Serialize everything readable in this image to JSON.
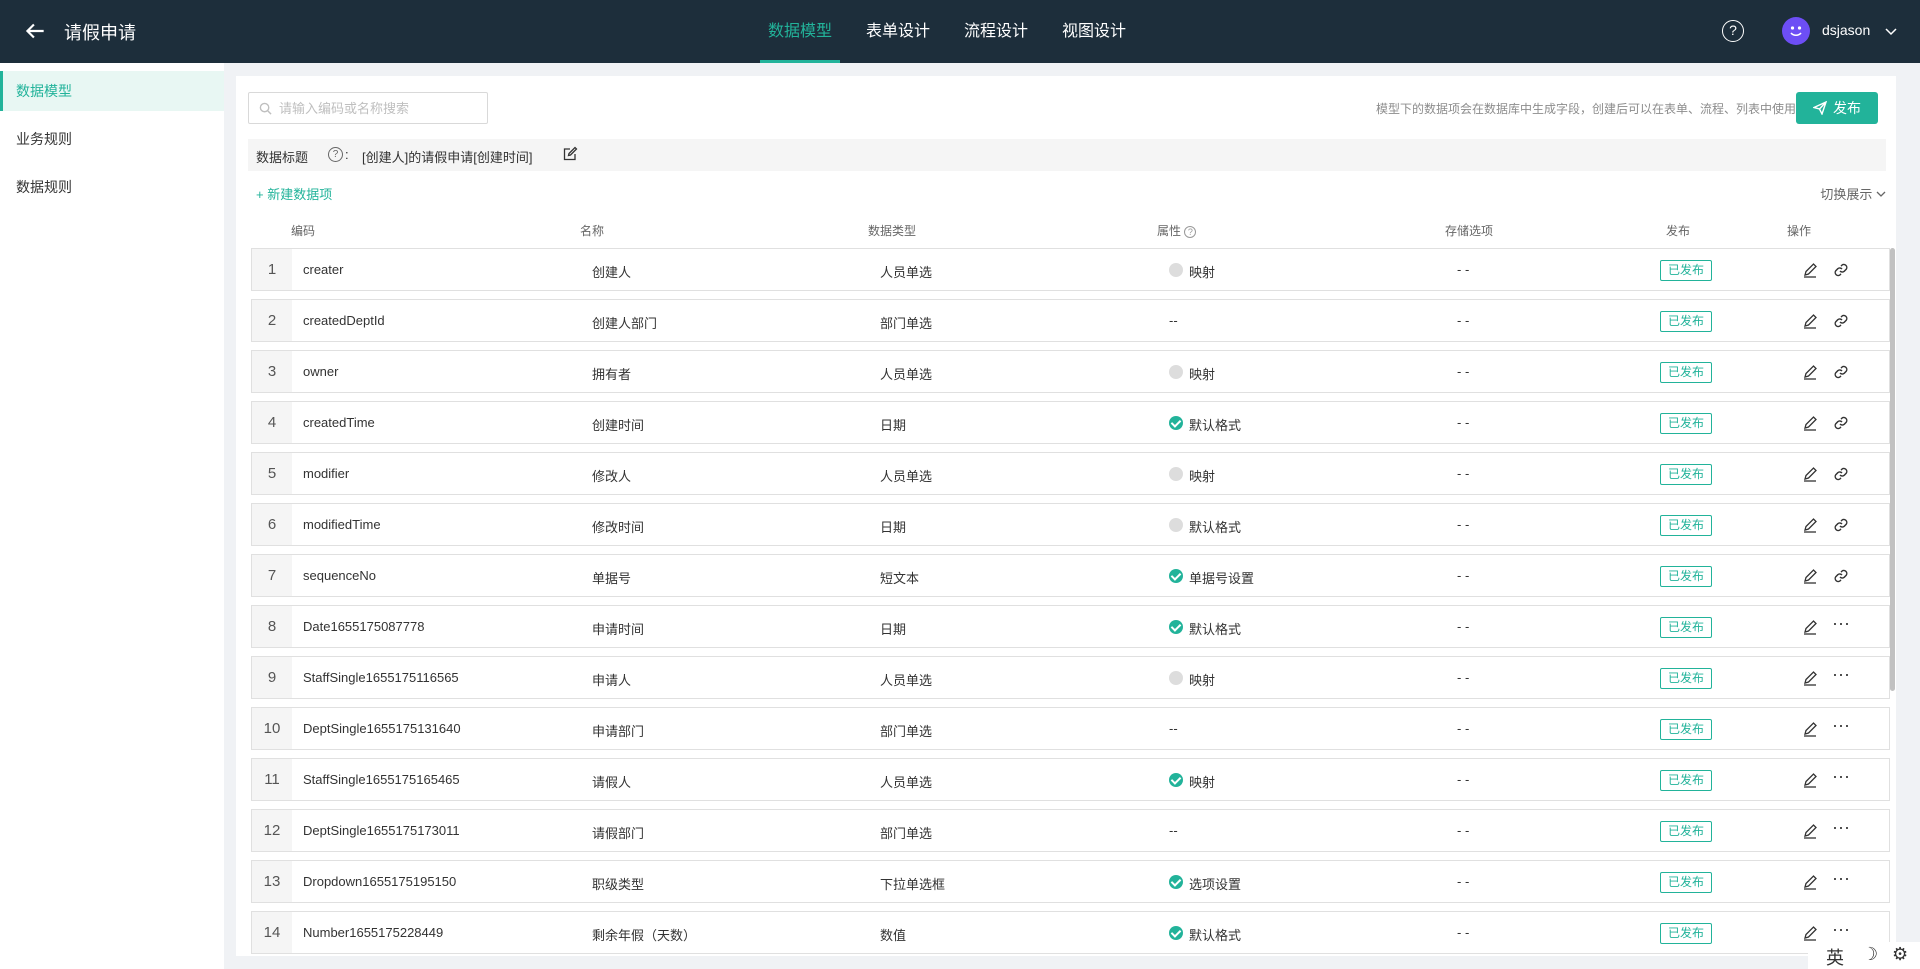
{
  "header": {
    "app_title": "请假申请",
    "tabs": [
      {
        "label": "数据模型",
        "active": true
      },
      {
        "label": "表单设计",
        "active": false
      },
      {
        "label": "流程设计",
        "active": false
      },
      {
        "label": "视图设计",
        "active": false
      }
    ],
    "help_label": "?",
    "user_name": "dsjason",
    "accent_color": "#22b39a",
    "bar_color": "#1d2e3b"
  },
  "sidebar": {
    "items": [
      {
        "label": "数据模型",
        "active": true
      },
      {
        "label": "业务规则",
        "active": false
      },
      {
        "label": "数据规则",
        "active": false
      }
    ]
  },
  "toolbar": {
    "search_placeholder": "请输入编码或名称搜索",
    "hint": "模型下的数据项会在数据库中生成字段，创建后可以在表单、流程、列表中使用。",
    "publish_label": "发布"
  },
  "title_bar": {
    "label": "数据标题",
    "help": "?",
    "colon": ":",
    "value": "[创建人]的请假申请[创建时间]"
  },
  "actions": {
    "new_item": "+ 新建数据项",
    "switch_view": "切换展示"
  },
  "table": {
    "headers": {
      "code": "编码",
      "name": "名称",
      "type": "数据类型",
      "attr": "属性",
      "storage": "存储选项",
      "publish": "发布",
      "ops": "操作"
    },
    "rows": [
      {
        "no": "1",
        "code": "creater",
        "name": "创建人",
        "type": "人员单选",
        "attr": "映射",
        "attr_on": false,
        "storage": "- -",
        "status": "已发布",
        "op": "link"
      },
      {
        "no": "2",
        "code": "createdDeptId",
        "name": "创建人部门",
        "type": "部门单选",
        "attr": "--",
        "attr_on": null,
        "storage": "- -",
        "status": "已发布",
        "op": "link"
      },
      {
        "no": "3",
        "code": "owner",
        "name": "拥有者",
        "type": "人员单选",
        "attr": "映射",
        "attr_on": false,
        "storage": "- -",
        "status": "已发布",
        "op": "link"
      },
      {
        "no": "4",
        "code": "createdTime",
        "name": "创建时间",
        "type": "日期",
        "attr": "默认格式",
        "attr_on": true,
        "storage": "- -",
        "status": "已发布",
        "op": "link"
      },
      {
        "no": "5",
        "code": "modifier",
        "name": "修改人",
        "type": "人员单选",
        "attr": "映射",
        "attr_on": false,
        "storage": "- -",
        "status": "已发布",
        "op": "link"
      },
      {
        "no": "6",
        "code": "modifiedTime",
        "name": "修改时间",
        "type": "日期",
        "attr": "默认格式",
        "attr_on": false,
        "storage": "- -",
        "status": "已发布",
        "op": "link"
      },
      {
        "no": "7",
        "code": "sequenceNo",
        "name": "单据号",
        "type": "短文本",
        "attr": "单据号设置",
        "attr_on": true,
        "storage": "- -",
        "status": "已发布",
        "op": "link"
      },
      {
        "no": "8",
        "code": "Date1655175087778",
        "name": "申请时间",
        "type": "日期",
        "attr": "默认格式",
        "attr_on": true,
        "storage": "- -",
        "status": "已发布",
        "op": "more"
      },
      {
        "no": "9",
        "code": "StaffSingle1655175116565",
        "name": "申请人",
        "type": "人员单选",
        "attr": "映射",
        "attr_on": false,
        "storage": "- -",
        "status": "已发布",
        "op": "more"
      },
      {
        "no": "10",
        "code": "DeptSingle1655175131640",
        "name": "申请部门",
        "type": "部门单选",
        "attr": "--",
        "attr_on": null,
        "storage": "- -",
        "status": "已发布",
        "op": "more"
      },
      {
        "no": "11",
        "code": "StaffSingle1655175165465",
        "name": "请假人",
        "type": "人员单选",
        "attr": "映射",
        "attr_on": true,
        "storage": "- -",
        "status": "已发布",
        "op": "more"
      },
      {
        "no": "12",
        "code": "DeptSingle1655175173011",
        "name": "请假部门",
        "type": "部门单选",
        "attr": "--",
        "attr_on": null,
        "storage": "- -",
        "status": "已发布",
        "op": "more"
      },
      {
        "no": "13",
        "code": "Dropdown1655175195150",
        "name": "职级类型",
        "type": "下拉单选框",
        "attr": "选项设置",
        "attr_on": true,
        "storage": "- -",
        "status": "已发布",
        "op": "more"
      },
      {
        "no": "14",
        "code": "Number1655175228449",
        "name": "剩余年假（天数）",
        "type": "数值",
        "attr": "默认格式",
        "attr_on": true,
        "storage": "- -",
        "status": "已发布",
        "op": "more"
      }
    ]
  },
  "ime": {
    "lang": "英",
    "moon": "☽",
    "gear": "⚙"
  }
}
